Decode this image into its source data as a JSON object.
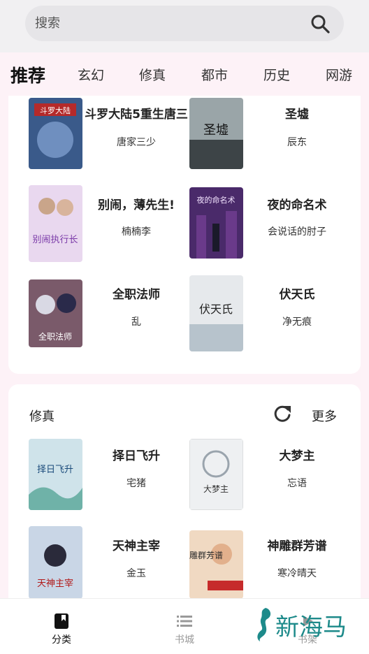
{
  "search": {
    "placeholder": "搜索",
    "icon": "search-icon"
  },
  "tabs": [
    {
      "label": "推荐",
      "active": true
    },
    {
      "label": "玄幻"
    },
    {
      "label": "修真"
    },
    {
      "label": "都市"
    },
    {
      "label": "历史"
    },
    {
      "label": "网游"
    }
  ],
  "recommend": {
    "books": [
      {
        "title": "斗罗大陆5重生唐三",
        "author": "唐家三少",
        "cover_text": "斗罗大陆",
        "cover_color": "#3a5a8a"
      },
      {
        "title": "圣墟",
        "author": "辰东",
        "cover_text": "圣墟",
        "cover_color": "#9aa5a8"
      },
      {
        "title": "别闹，薄先生!",
        "author": "楠楠李",
        "cover_text": "别闹执行长",
        "cover_color": "#e9d8ef"
      },
      {
        "title": "夜的命名术",
        "author": "会说话的肘子",
        "cover_text": "夜的命名术",
        "cover_color": "#4a2a6a"
      },
      {
        "title": "全职法师",
        "author": "乱",
        "cover_text": "全职法师",
        "cover_color": "#7a5a6a"
      },
      {
        "title": "伏天氏",
        "author": "净无痕",
        "cover_text": "伏天氏",
        "cover_color": "#e6e9ec"
      }
    ]
  },
  "xiuzhen": {
    "title": "修真",
    "more": "更多",
    "books": [
      {
        "title": "择日飞升",
        "author": "宅猪",
        "cover_text": "择日飞升",
        "cover_color": "#cfe3ea"
      },
      {
        "title": "大梦主",
        "author": "忘语",
        "cover_text": "大梦主",
        "cover_color": "#eef0f2"
      },
      {
        "title": "天神主宰",
        "author": "金玉",
        "cover_text": "天神主宰",
        "cover_color": "#c9d6e6"
      },
      {
        "title": "神雕群芳谱",
        "author": "寒冷晴天",
        "cover_text": "神雕群芳谱",
        "cover_color": "#f0d9c2"
      }
    ]
  },
  "nav": [
    {
      "label": "分类",
      "icon": "book-icon",
      "active": true
    },
    {
      "label": "书城",
      "icon": "list-icon"
    },
    {
      "label": "书架",
      "icon": "shelf-icon"
    }
  ],
  "watermark": "新海马"
}
